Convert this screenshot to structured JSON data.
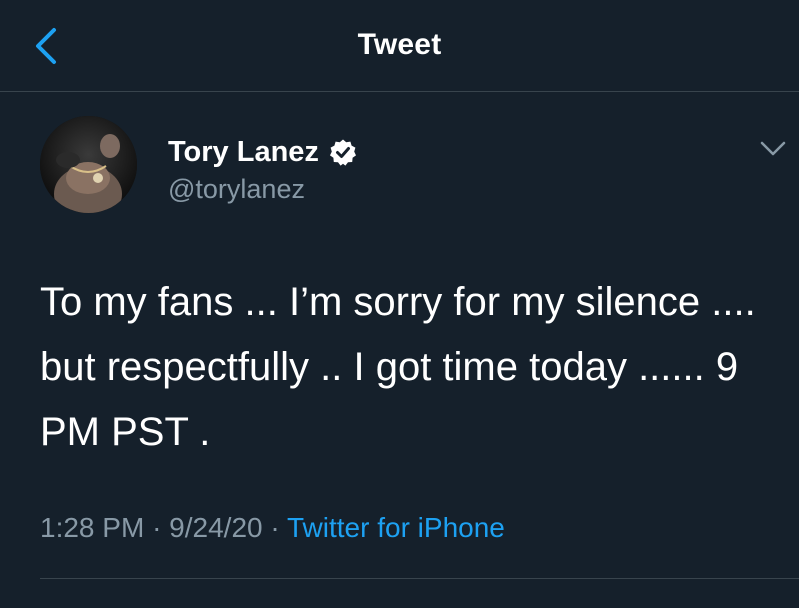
{
  "header": {
    "title": "Tweet",
    "back_icon": "chevron-left-icon"
  },
  "tweet": {
    "author_name": "Tory Lanez",
    "handle": "@torylanez",
    "verified": true,
    "text": "To my fans ... I’m sorry for my silence .... but respectfully .. I got time today ...... 9 PM PST .",
    "time": "1:28 PM",
    "date": "9/24/20",
    "separator": "·",
    "source": "Twitter for iPhone"
  },
  "colors": {
    "background": "#15202b",
    "accent": "#1da1f2",
    "secondary_text": "#8899a6",
    "divider": "#38444d"
  }
}
